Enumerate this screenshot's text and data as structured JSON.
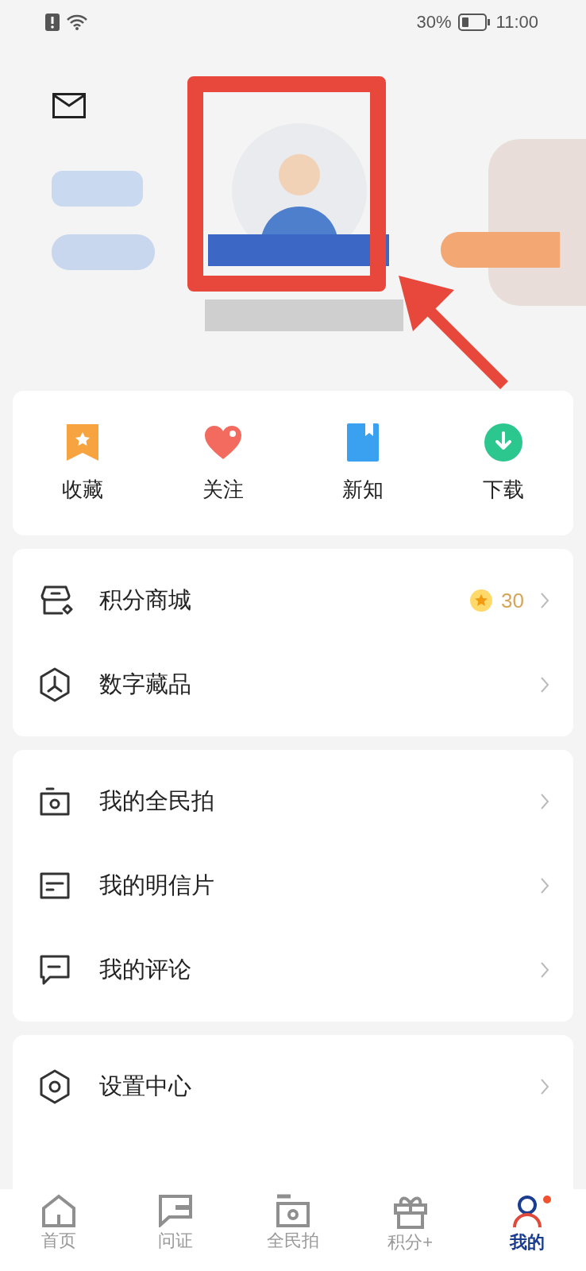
{
  "status_bar": {
    "battery": "30%",
    "time": "11:00"
  },
  "quick_actions": [
    {
      "kind": "bookmark",
      "label": "收藏"
    },
    {
      "kind": "heart",
      "label": "关注"
    },
    {
      "kind": "book",
      "label": "新知"
    },
    {
      "kind": "download",
      "label": "下载"
    }
  ],
  "menu_groups": [
    [
      {
        "kind": "store",
        "label": "积分商城",
        "points": "30"
      },
      {
        "kind": "cube",
        "label": "数字藏品"
      }
    ],
    [
      {
        "kind": "camera",
        "label": "我的全民拍"
      },
      {
        "kind": "card",
        "label": "我的明信片"
      },
      {
        "kind": "comment",
        "label": "我的评论"
      }
    ],
    [
      {
        "kind": "settings",
        "label": "设置中心"
      }
    ]
  ],
  "tab_bar": [
    {
      "kind": "home",
      "label": "首页",
      "selected": false,
      "dot": false
    },
    {
      "kind": "chat",
      "label": "问证",
      "selected": false,
      "dot": false
    },
    {
      "label": "全民拍",
      "selected": false,
      "dot": false
    },
    {
      "kind": "gift",
      "label": "积分+",
      "selected": false,
      "dot": false
    },
    {
      "kind": "user",
      "label": "我的",
      "selected": true,
      "dot": true
    }
  ]
}
